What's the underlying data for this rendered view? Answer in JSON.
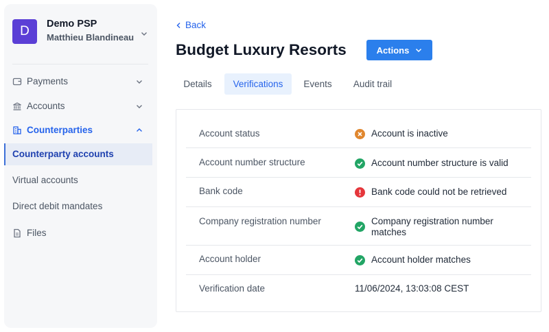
{
  "org": {
    "initial": "D",
    "name": "Demo PSP",
    "user": "Matthieu Blandineau"
  },
  "nav": {
    "payments": "Payments",
    "accounts": "Accounts",
    "counterparties": "Counterparties",
    "sub": [
      "Counterparty accounts",
      "Virtual accounts",
      "Direct debit mandates"
    ],
    "files": "Files"
  },
  "page": {
    "back_label": "Back",
    "title": "Budget Luxury Resorts",
    "actions_label": "Actions"
  },
  "tabs": [
    "Details",
    "Verifications",
    "Events",
    "Audit trail"
  ],
  "active_tab": "Verifications",
  "verifications": [
    {
      "label": "Account status",
      "status": "warning",
      "value": "Account is inactive"
    },
    {
      "label": "Account number structure",
      "status": "success",
      "value": "Account number structure is valid"
    },
    {
      "label": "Bank code",
      "status": "error",
      "value": "Bank code could not be retrieved"
    },
    {
      "label": "Company registration number",
      "status": "success",
      "value": "Company registration number matches"
    },
    {
      "label": "Account holder",
      "status": "success",
      "value": "Account holder matches"
    },
    {
      "label": "Verification date",
      "status": "none",
      "value": "11/06/2024, 13:03:08 CEST"
    }
  ],
  "colors": {
    "accent": "#2b7fec",
    "success": "#22a565",
    "warning": "#e0872f",
    "error": "#e5363b",
    "avatar": "#5b3fd6"
  }
}
